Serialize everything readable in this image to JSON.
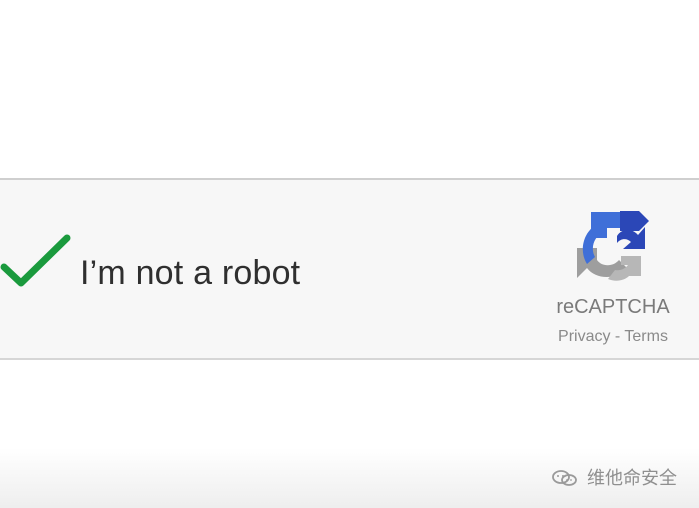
{
  "captcha": {
    "checkbox_label": "I’m not a robot",
    "checked": true,
    "brand_name": "reCAPTCHA",
    "privacy_label": "Privacy",
    "separator": "-",
    "terms_label": "Terms",
    "icons": {
      "checkmark": "checkmark-icon",
      "logo": "recaptcha-logo-icon"
    },
    "colors": {
      "checkmark": "#1a9a3d",
      "logo_blue": "#3f6fd8",
      "logo_dark_blue": "#2b47b7",
      "logo_gray": "#9e9e9e",
      "label": "#2f2f2f",
      "secondary_text": "#7a7a7a"
    }
  },
  "watermark": {
    "text": "维他命安全",
    "icon": "wechat-icon"
  }
}
